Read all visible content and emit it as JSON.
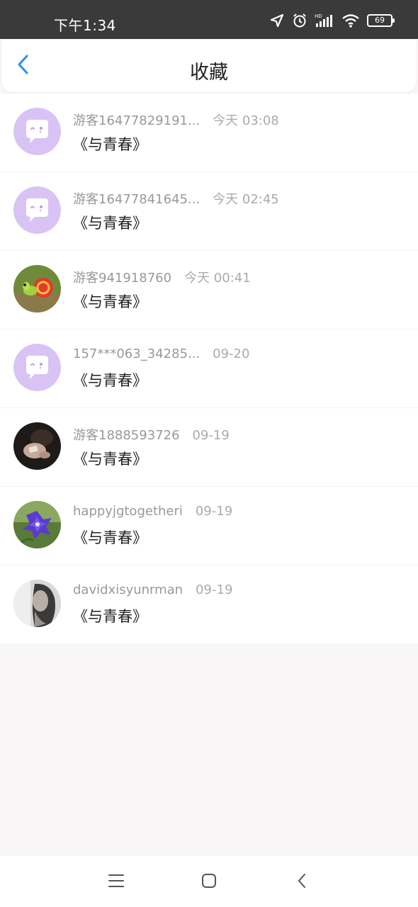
{
  "status_bar": {
    "time": "下午1:34",
    "battery": "69",
    "icons": [
      "location-arrow-icon",
      "alarm-clock-icon",
      "hd-signal-icon",
      "wifi-icon",
      "battery-icon"
    ]
  },
  "header": {
    "title": "收藏",
    "back_icon": "chevron-left-icon",
    "accent_color": "#2f8cf0"
  },
  "favorites": [
    {
      "username": "游客16477829191...",
      "time": "今天 03:08",
      "title": "《与青春》",
      "avatar": "default-chat-bubble"
    },
    {
      "username": "游客16477841645...",
      "time": "今天 02:45",
      "title": "《与青春》",
      "avatar": "default-chat-bubble"
    },
    {
      "username": "游客941918760",
      "time": "今天 00:41",
      "title": "《与青春》",
      "avatar": "snail-photo"
    },
    {
      "username": "157***063_34285...",
      "time": "09-20",
      "title": "《与青春》",
      "avatar": "default-chat-bubble"
    },
    {
      "username": "游客1888593726",
      "time": "09-19",
      "title": "《与青春》",
      "avatar": "hand-photo"
    },
    {
      "username": "happyjgtogetheri",
      "time": "09-19",
      "title": "《与青春》",
      "avatar": "purple-flower-photo"
    },
    {
      "username": "davidxisyunrman",
      "time": "09-19",
      "title": "《与青春》",
      "avatar": "woman-portrait-photo"
    }
  ],
  "bottom_nav": {
    "icons": [
      "menu-icon",
      "home-square-icon",
      "back-triangle-icon"
    ]
  }
}
